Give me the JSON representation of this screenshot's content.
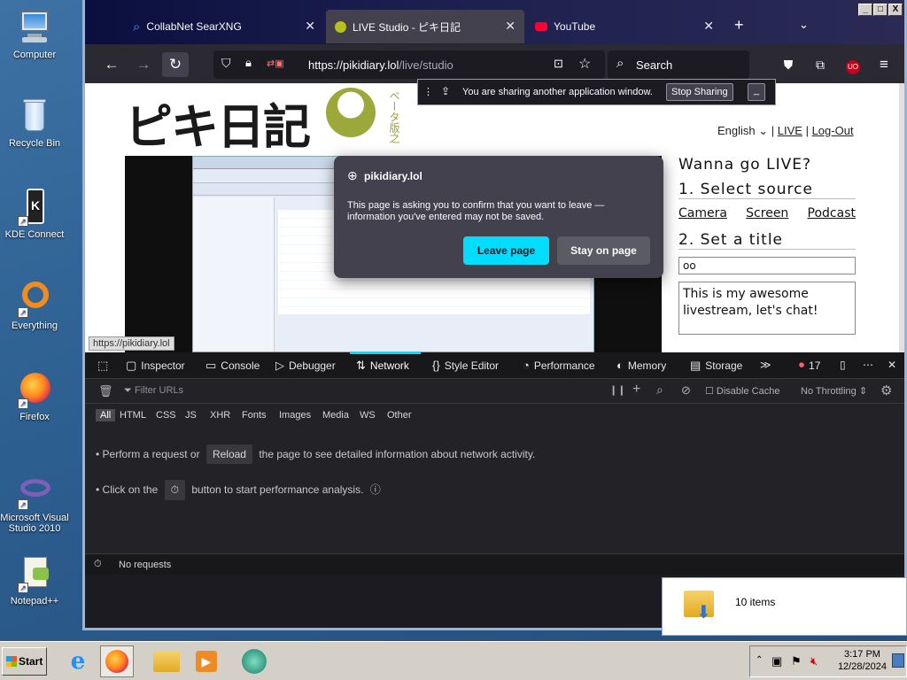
{
  "desktop": {
    "icons": [
      {
        "label": "Computer"
      },
      {
        "label": "Recycle Bin"
      },
      {
        "label": "KDE Connect"
      },
      {
        "label": "Everything"
      },
      {
        "label": "Firefox"
      },
      {
        "label": "Microsoft Visual Studio 2010"
      },
      {
        "label": "Notepad++"
      }
    ]
  },
  "browser": {
    "tabs": [
      {
        "title": "CollabNet SearXNG",
        "icon": "search-icon"
      },
      {
        "title": "LIVE Studio - ピキ日記",
        "icon": "pikidiary-icon",
        "active": true
      },
      {
        "title": "YouTube",
        "icon": "youtube-icon"
      }
    ],
    "url_host": "https://pikidiary.lol",
    "url_path": "/live/studio",
    "search_placeholder": "Search",
    "window_controls": [
      "_",
      "□",
      "X"
    ]
  },
  "sharing_bar": {
    "message": "You are sharing another application window.",
    "stop_label": "Stop Sharing",
    "minimize_label": "_"
  },
  "page": {
    "logo_text": "ピキ日記",
    "beta_text": "ベータ版之",
    "language": "English",
    "nav_live": "LIVE",
    "nav_logout": "Log-Out",
    "live_heading": "Wanna go LIVE?",
    "step1": "1. Select source",
    "sources": [
      "Camera",
      "Screen",
      "Podcast"
    ],
    "step2": "2. Set a title",
    "title_value": "oo",
    "description_value": "This is my awesome livestream, let's chat!",
    "hover_link": "https://pikidiary.lol"
  },
  "dialog": {
    "site": "pikidiary.lol",
    "message": "This page is asking you to confirm that you want to leave — information you've entered may not be saved.",
    "leave_label": "Leave page",
    "stay_label": "Stay on page",
    "leave_color": "#00ddff"
  },
  "devtools": {
    "tabs": [
      {
        "label": "Inspector",
        "icon": "inspector-icon"
      },
      {
        "label": "Console",
        "icon": "console-icon"
      },
      {
        "label": "Debugger",
        "icon": "debugger-icon"
      },
      {
        "label": "Network",
        "icon": "network-icon",
        "selected": true
      },
      {
        "label": "Style Editor",
        "icon": "style-editor-icon"
      },
      {
        "label": "Performance",
        "icon": "performance-icon"
      },
      {
        "label": "Memory",
        "icon": "memory-icon"
      },
      {
        "label": "Storage",
        "icon": "storage-icon"
      }
    ],
    "error_count": "17",
    "filter_placeholder": "Filter URLs",
    "disable_cache_label": "Disable Cache",
    "throttling_label": "No Throttling",
    "type_filters": [
      "All",
      "HTML",
      "CSS",
      "JS",
      "XHR",
      "Fonts",
      "Images",
      "Media",
      "WS",
      "Other"
    ],
    "line1_before": "Perform a request or",
    "line1_button": "Reload",
    "line1_after": "the page to see detailed information about network activity.",
    "line2_before": "Click on the",
    "line2_after": "button to start performance analysis.",
    "status": "No requests"
  },
  "explorer_pane": {
    "item_count": "10 items"
  },
  "taskbar": {
    "start_label": "Start",
    "clock_time": "3:17 PM",
    "clock_date": "12/28/2024"
  }
}
